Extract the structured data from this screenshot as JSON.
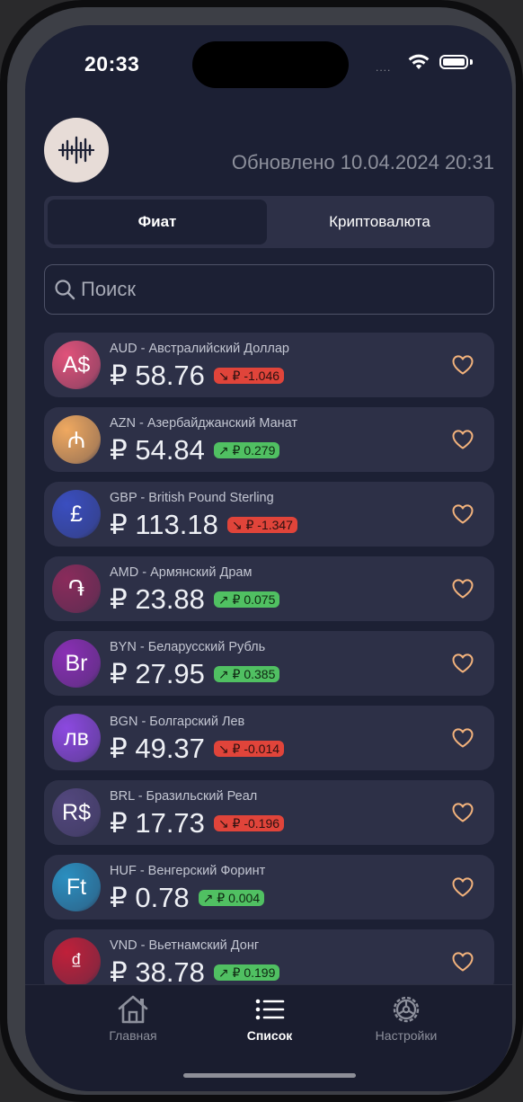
{
  "status_bar": {
    "time": "20:33",
    "signal": "....",
    "icons": [
      "wifi-icon",
      "battery-icon"
    ]
  },
  "header": {
    "logo_icon": "chart-logo-icon",
    "updated_text": "Обновлено 10.04.2024 20:31"
  },
  "segments": {
    "fiat": "Фиат",
    "crypto": "Криптовалюта",
    "selected": "fiat"
  },
  "search": {
    "placeholder": "Поиск",
    "value": ""
  },
  "currencies": [
    {
      "symbol": "A$",
      "name": "AUD - Австралийский Доллар",
      "rate": "₽ 58.76",
      "change": "↘ ₽ -1.046",
      "trend": "down",
      "color": "#e0527a"
    },
    {
      "symbol": "₼",
      "name": "AZN - Азербайджанский Манат",
      "rate": "₽ 54.84",
      "change": "↗ ₽ 0.279",
      "trend": "up",
      "color": "#f0a960"
    },
    {
      "symbol": "£",
      "name": "GBP - British Pound Sterling",
      "rate": "₽ 113.18",
      "change": "↘ ₽ -1.347",
      "trend": "down",
      "color": "#3a4ec0"
    },
    {
      "symbol": "֏",
      "name": "AMD - Армянский Драм",
      "rate": "₽ 23.88",
      "change": "↗ ₽ 0.075",
      "trend": "up",
      "color": "#8a2b5b"
    },
    {
      "symbol": "Br",
      "name": "BYN - Беларусский Рубль",
      "rate": "₽ 27.95",
      "change": "↗ ₽ 0.385",
      "trend": "up",
      "color": "#8a2fb5"
    },
    {
      "symbol": "лв",
      "name": "BGN - Болгарский Лев",
      "rate": "₽ 49.37",
      "change": "↘ ₽ -0.014",
      "trend": "down",
      "color": "#8c49e0"
    },
    {
      "symbol": "R$",
      "name": "BRL - Бразильский Реал",
      "rate": "₽ 17.73",
      "change": "↘ ₽ -0.196",
      "trend": "down",
      "color": "#53477e"
    },
    {
      "symbol": "Ft",
      "name": "HUF - Венгерский Форинт",
      "rate": "₽ 0.78",
      "change": "↗ ₽ 0.004",
      "trend": "up",
      "color": "#2b8fc0"
    },
    {
      "symbol": "₫",
      "name": "VND - Вьетнамский Донг",
      "rate": "₽ 38.78",
      "change": "↗ ₽ 0.199",
      "trend": "up",
      "color": "#c0203a"
    }
  ],
  "tabbar": {
    "items": [
      {
        "label": "Главная",
        "icon": "home-icon"
      },
      {
        "label": "Список",
        "icon": "list-icon"
      },
      {
        "label": "Настройки",
        "icon": "settings-gear-icon"
      }
    ],
    "active": "Список"
  },
  "colors": {
    "background": "#1c2034",
    "card": "#2d3047",
    "negative": "#e0443a",
    "positive": "#50c062",
    "heart": "#f2b27c"
  }
}
